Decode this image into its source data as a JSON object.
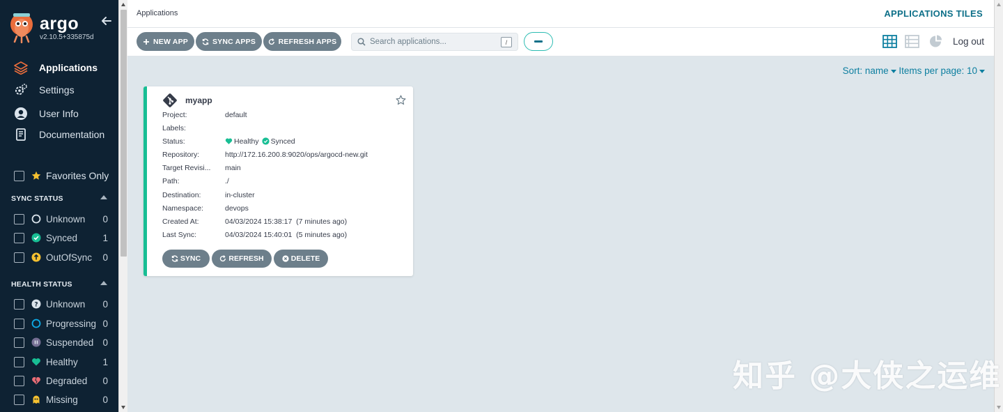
{
  "sidebar": {
    "brand": "argo",
    "version": "v2.10.5+335875d",
    "nav": [
      {
        "label": "Applications",
        "icon": "layers-icon",
        "active": true
      },
      {
        "label": "Settings",
        "icon": "gears-icon"
      },
      {
        "label": "User Info",
        "icon": "user-icon"
      },
      {
        "label": "Documentation",
        "icon": "book-icon"
      }
    ],
    "favorites_label": "Favorites Only",
    "sync_status": {
      "title": "SYNC STATUS",
      "items": [
        {
          "label": "Unknown",
          "count": "0",
          "icon": "circle-outline-icon"
        },
        {
          "label": "Synced",
          "count": "1",
          "icon": "check-circle-icon"
        },
        {
          "label": "OutOfSync",
          "count": "0",
          "icon": "arrow-up-circle-icon"
        }
      ]
    },
    "health_status": {
      "title": "HEALTH STATUS",
      "items": [
        {
          "label": "Unknown",
          "count": "0",
          "icon": "question-circle-icon"
        },
        {
          "label": "Progressing",
          "count": "0",
          "icon": "progress-circle-icon"
        },
        {
          "label": "Suspended",
          "count": "0",
          "icon": "pause-circle-icon"
        },
        {
          "label": "Healthy",
          "count": "1",
          "icon": "heart-icon"
        },
        {
          "label": "Degraded",
          "count": "0",
          "icon": "broken-heart-icon"
        },
        {
          "label": "Missing",
          "count": "0",
          "icon": "ghost-icon"
        }
      ]
    }
  },
  "topbar": {
    "breadcrumb": "Applications",
    "title": "APPLICATIONS TILES"
  },
  "toolbar": {
    "new_app": "NEW APP",
    "sync_apps": "SYNC APPS",
    "refresh_apps": "REFRESH APPS",
    "search_placeholder": "Search applications...",
    "search_shortcut": "/",
    "logout": "Log out"
  },
  "sort": {
    "sort_label": "Sort: name",
    "items_label": "Items per page: 10"
  },
  "app": {
    "name": "myapp",
    "fields": {
      "project_k": "Project:",
      "project_v": "default",
      "labels_k": "Labels:",
      "labels_v": "",
      "status_k": "Status:",
      "health_v": "Healthy",
      "sync_v": "Synced",
      "repo_k": "Repository:",
      "repo_v": "http://172.16.200.8:9020/ops/argocd-new.git",
      "rev_k": "Target Revisi...",
      "rev_v": "main",
      "path_k": "Path:",
      "path_v": "./",
      "dest_k": "Destination:",
      "dest_v": "in-cluster",
      "ns_k": "Namespace:",
      "ns_v": "devops",
      "created_k": "Created At:",
      "created_v": "04/03/2024 15:38:17  (7 minutes ago)",
      "lastsync_k": "Last Sync:",
      "lastsync_v": "04/03/2024 15:40:01  (5 minutes ago)"
    },
    "buttons": {
      "sync": "SYNC",
      "refresh": "REFRESH",
      "delete": "DELETE"
    }
  },
  "watermark": "知乎 @大侠之运维",
  "colors": {
    "sidebar": "#0e2233",
    "accent": "#0d6f88",
    "healthy": "#18be94",
    "button": "#6d7f8b",
    "out_of_sync": "#f4c030",
    "degraded": "#e96d76"
  }
}
